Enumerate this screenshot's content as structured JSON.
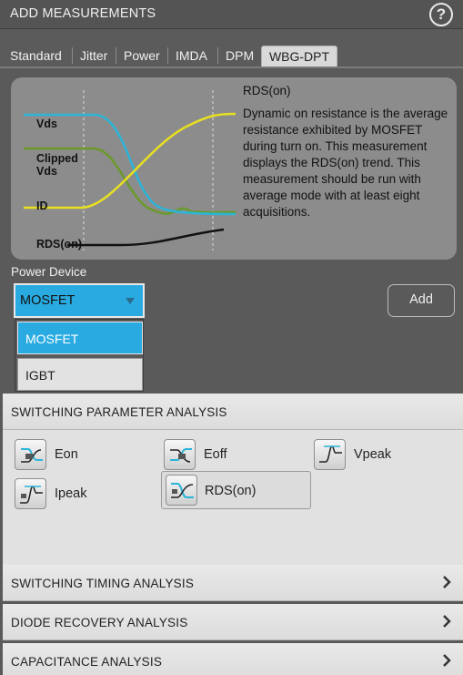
{
  "window": {
    "title": "ADD MEASUREMENTS",
    "help_label": "?"
  },
  "tabs": [
    {
      "label": "Standard",
      "active": false
    },
    {
      "label": "Jitter",
      "active": false
    },
    {
      "label": "Power",
      "active": false
    },
    {
      "label": "IMDA",
      "active": false
    },
    {
      "label": "DPM",
      "active": false
    },
    {
      "label": "WBG-DPT",
      "active": true
    }
  ],
  "info": {
    "title": "RDS(on)",
    "description": "Dynamic on resistance is the average resistance exhibited by MOSFET during turn on. This measurement displays the RDS(on) trend. This measurement should be run with average mode with at least eight acquisitions.",
    "diagram_labels": {
      "vds": "Vds",
      "clipped_1": "Clipped",
      "clipped_2": "Vds",
      "id": "ID",
      "rdson": "RDS(on)"
    },
    "diagram_colors": {
      "vds": "#2bb5d8",
      "clipped_vds": "#6a9a2a",
      "id": "#e8e020",
      "rdson": "#111111",
      "marker": "#dddddd"
    }
  },
  "power_device": {
    "label": "Power Device",
    "selected": "MOSFET",
    "options": [
      "MOSFET",
      "IGBT"
    ]
  },
  "add_button": "Add",
  "sections": {
    "switching_parameter": {
      "title": "SWITCHING PARAMETER ANALYSIS",
      "items": [
        {
          "label": "Eon",
          "icon": "eon-icon"
        },
        {
          "label": "Eoff",
          "icon": "eoff-icon"
        },
        {
          "label": "Vpeak",
          "icon": "vpeak-icon"
        },
        {
          "label": "Ipeak",
          "icon": "ipeak-icon"
        },
        {
          "label": "RDS(on)",
          "icon": "rdson-icon"
        }
      ]
    },
    "switching_timing": {
      "title": "SWITCHING TIMING ANALYSIS"
    },
    "diode_recovery": {
      "title": "DIODE RECOVERY ANALYSIS"
    },
    "capacitance": {
      "title": "CAPACITANCE ANALYSIS"
    }
  },
  "colors": {
    "accent": "#29abe2",
    "panel": "#8c8c8c",
    "background": "#5a5a5a"
  }
}
